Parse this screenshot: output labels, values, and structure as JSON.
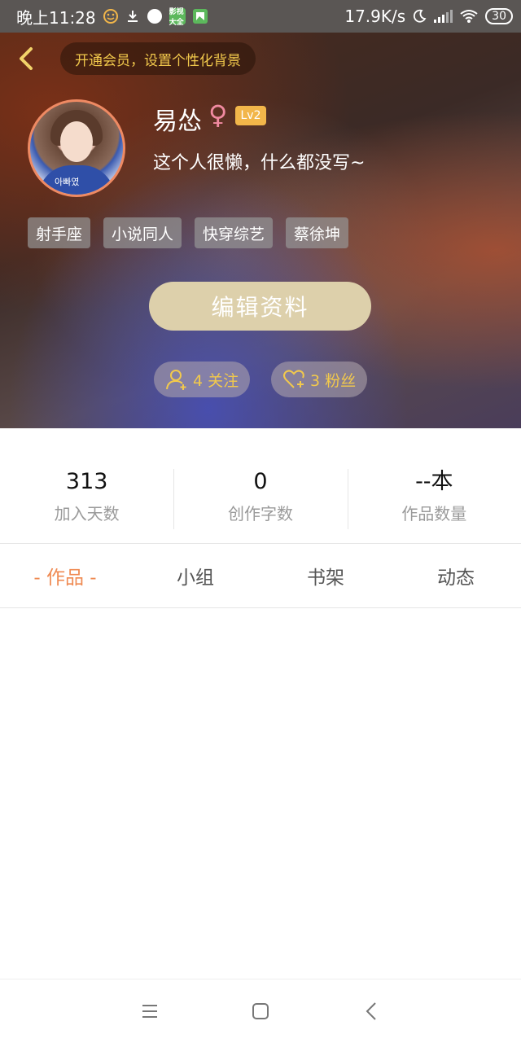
{
  "status_bar": {
    "time": "晚上11:28",
    "net_speed": "17.9K/s",
    "battery": "30",
    "app_badge": "影视大全"
  },
  "header": {
    "vip_prompt": "开通会员，设置个性化背景"
  },
  "profile": {
    "name": "易怂",
    "gender_symbol": "♀",
    "level": "Lv2",
    "bio": "这个人很懒，什么都没写~",
    "avatar_text": "아빠였",
    "tags": [
      "射手座",
      "小说同人",
      "快穿综艺",
      "蔡徐坤"
    ]
  },
  "actions": {
    "edit_profile": "编辑资料",
    "following": "4 关注",
    "fans": "3 粉丝"
  },
  "stats": [
    {
      "value": "313",
      "label": "加入天数"
    },
    {
      "value": "0",
      "label": "创作字数"
    },
    {
      "value": "--本",
      "label": "作品数量"
    }
  ],
  "tabs": [
    {
      "label": "- 作品 -",
      "active": true
    },
    {
      "label": "小组",
      "active": false
    },
    {
      "label": "书架",
      "active": false
    },
    {
      "label": "动态",
      "active": false
    }
  ],
  "colors": {
    "accent": "#ef8a52",
    "gold": "#f2c94c",
    "edit_button": "#ddd0ab",
    "level_badge": "#f2b64a",
    "avatar_ring": "#ef8a63"
  },
  "icons": [
    "back-chevron-icon",
    "user-plus-icon",
    "heart-plus-icon",
    "menu-icon",
    "home-square-icon",
    "back-triangle-icon"
  ]
}
